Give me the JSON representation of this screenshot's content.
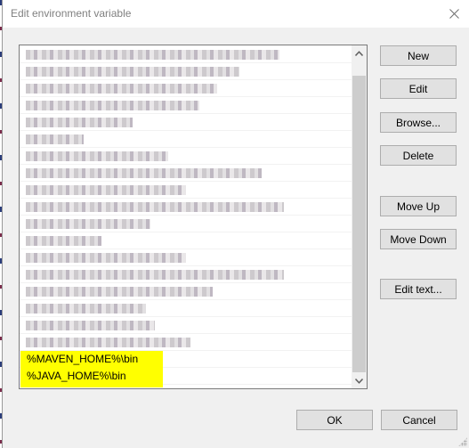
{
  "window": {
    "title": "Edit environment variable",
    "close_icon": "close-icon"
  },
  "list": {
    "redacted_rows": [
      {
        "label": "[redacted path 1]",
        "width_chars": 57
      },
      {
        "label": "[redacted path 2]",
        "width_chars": 48
      },
      {
        "label": "[redacted path 3]",
        "width_chars": 43
      },
      {
        "label": "[redacted path 4]",
        "width_chars": 39
      },
      {
        "label": "[redacted path 5]",
        "width_chars": 24
      },
      {
        "label": "[redacted path 6]",
        "width_chars": 13
      },
      {
        "label": "[redacted path 7]",
        "width_chars": 32
      },
      {
        "label": "[redacted path 8]",
        "width_chars": 53
      },
      {
        "label": "[redacted path 9]",
        "width_chars": 36
      },
      {
        "label": "[redacted path 10]",
        "width_chars": 58
      },
      {
        "label": "[redacted path 11]",
        "width_chars": 28
      },
      {
        "label": "[redacted path 12]",
        "width_chars": 17
      },
      {
        "label": "[redacted path 13]",
        "width_chars": 36
      },
      {
        "label": "[redacted path 14]",
        "width_chars": 58
      },
      {
        "label": "[redacted path 15]",
        "width_chars": 42
      },
      {
        "label": "[redacted path 16]",
        "width_chars": 27
      },
      {
        "label": "[redacted path 17]",
        "width_chars": 29
      },
      {
        "label": "[redacted path 18]",
        "width_chars": 37
      }
    ],
    "highlighted_rows": [
      {
        "value": "%MAVEN_HOME%\\bin"
      },
      {
        "value": "%JAVA_HOME%\\bin"
      }
    ],
    "highlight_color": "#ffff00",
    "scroll_up_icon": "chevron-up-icon",
    "scroll_down_icon": "chevron-down-icon"
  },
  "buttons": {
    "new": "New",
    "edit": "Edit",
    "browse": "Browse...",
    "delete": "Delete",
    "move_up": "Move Up",
    "move_down": "Move Down",
    "edit_text": "Edit text...",
    "ok": "OK",
    "cancel": "Cancel"
  }
}
